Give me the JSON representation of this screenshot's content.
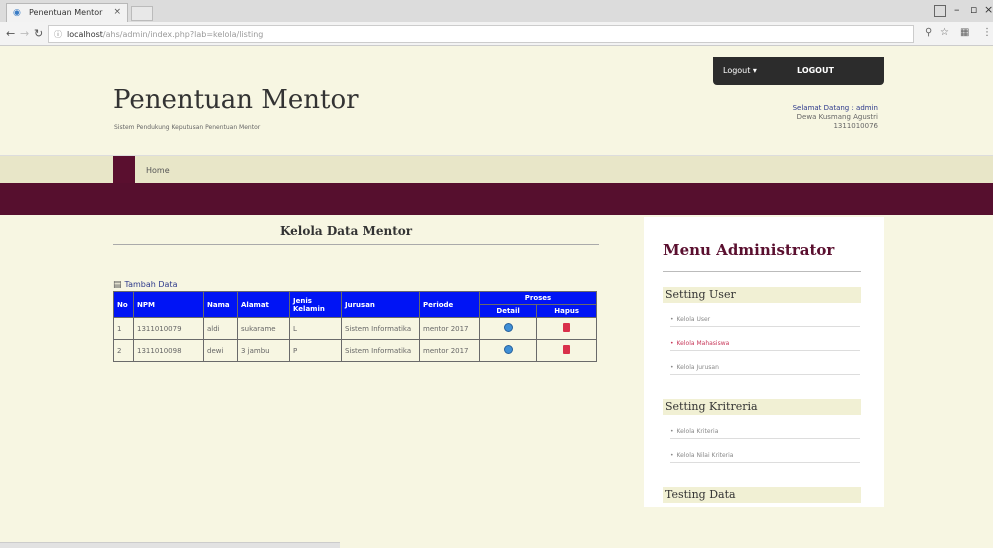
{
  "browser": {
    "tab_title": "Penentuan Mentor",
    "url_host": "localhost",
    "url_path": "/ahs/admin/index.php?lab=kelola/listing"
  },
  "topbar": {
    "login_label": "Logout ▾",
    "logout_label": "LOGOUT"
  },
  "header": {
    "title": "Penentuan Mentor",
    "subtitle": "Sistem Pendukung Keputusan Penentuan Mentor",
    "welcome_line": "Selamat Datang : admin",
    "user_name": "Dewa Kusmang Agustri",
    "user_id": "1311010076"
  },
  "nav": {
    "home": "Home"
  },
  "content": {
    "title": "Kelola Data Mentor",
    "add_link": "Tambah Data",
    "table": {
      "headers": {
        "no": "No",
        "npm": "NPM",
        "nama": "Nama",
        "alamat": "Alamat",
        "jenis_kelamin": "Jenis Kelamin",
        "jurusan": "Jurusan",
        "periode": "Periode",
        "proses": "Proses",
        "detail": "Detail",
        "hapus": "Hapus"
      },
      "rows": [
        {
          "no": "1",
          "npm": "1311010079",
          "nama": "aldi",
          "alamat": "sukarame",
          "jk": "L",
          "jurusan": "Sistem Informatika",
          "periode": "mentor 2017"
        },
        {
          "no": "2",
          "npm": "1311010098",
          "nama": "dewi",
          "alamat": "3 jambu",
          "jk": "P",
          "jurusan": "Sistem Informatika",
          "periode": "mentor 2017"
        }
      ]
    }
  },
  "sidebar": {
    "title": "Menu Administrator",
    "sections": [
      {
        "label": "Setting User",
        "items": [
          "Kelola User",
          "Kelola Mahasiswa",
          "Kelola Jurusan"
        ]
      },
      {
        "label": "Setting Kritreria",
        "items": [
          "Kelola Kriteria",
          "Kelola Nilai Kriteria"
        ]
      },
      {
        "label": "Testing Data",
        "items": []
      }
    ]
  }
}
